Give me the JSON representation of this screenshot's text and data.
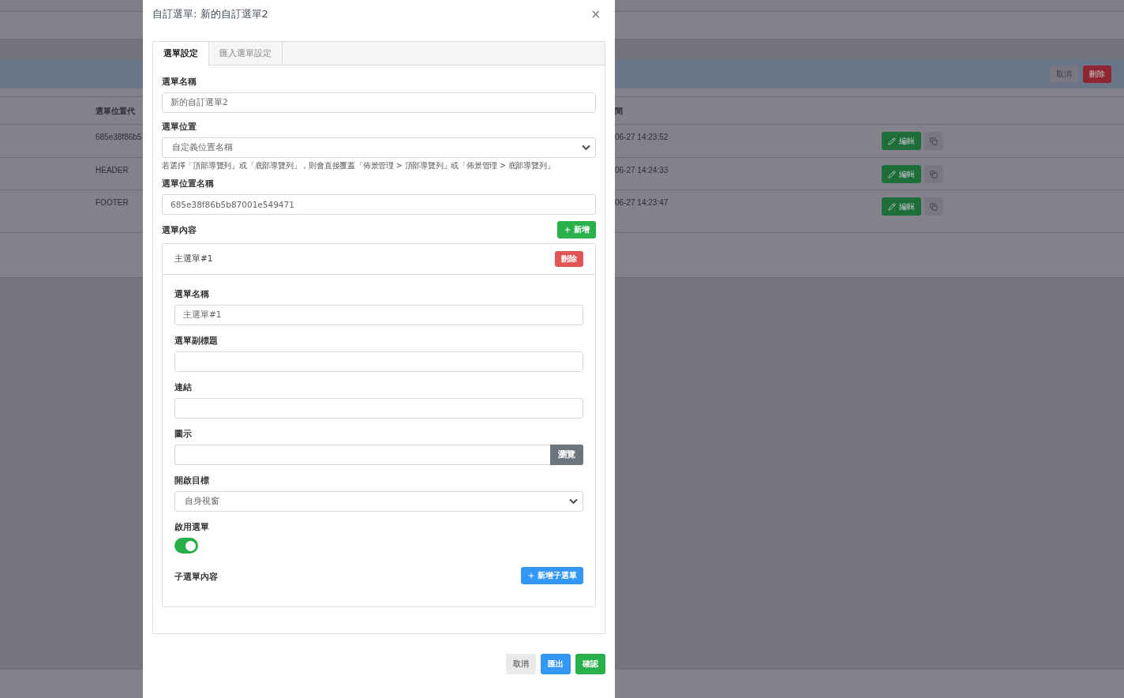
{
  "background": {
    "header_actions": [
      {
        "label": "取消",
        "kind": "secondary"
      },
      {
        "label": "刪除",
        "kind": "danger"
      }
    ],
    "table": {
      "column_1": "選單位置代",
      "column_2": "間",
      "rows": [
        {
          "column_1": "685e38f86b5",
          "column_2": "06-27 14:23:52",
          "action": "編輯"
        },
        {
          "column_1": "HEADER",
          "column_2": "06-27 14:24:33",
          "action": "編輯"
        },
        {
          "column_1": "FOOTER",
          "column_2": "06-27 14:23:47",
          "action": "編輯"
        }
      ]
    }
  },
  "modal": {
    "title": "自訂選單: 新的自訂選單2",
    "close": "×",
    "tabs": [
      {
        "label": "選單設定",
        "selected": true
      },
      {
        "label": "匯入選單設定",
        "selected": false
      }
    ],
    "menu_name": {
      "label": "選單名稱",
      "value": "新的自訂選單2"
    },
    "menu_position": {
      "label": "選單位置",
      "value": "自定義位置名稱",
      "help": "若選擇「頂部導覽列」或「底部導覽列」，則會直接覆蓋「佈景管理 > 頂部導覽列」或「佈景管理 > 底部導覽列」"
    },
    "position_name": {
      "label": "選單位置名稱",
      "value": "685e38f86b5b87001e549471"
    },
    "content": {
      "label": "選單內容",
      "add_button": "新增",
      "items": [
        {
          "title": "主選單#1",
          "delete_button": "刪除",
          "fields": [
            {
              "kind": "text",
              "label": "選單名稱",
              "value": "主選單#1"
            },
            {
              "kind": "text",
              "label": "選單副標題"
            },
            {
              "kind": "text",
              "label": "連結"
            },
            {
              "kind": "file",
              "label": "圖示",
              "button": "瀏覽"
            },
            {
              "kind": "select",
              "label": "開啟目標",
              "value": "自身視窗"
            },
            {
              "kind": "toggle",
              "label": "啟用選單",
              "on": true
            }
          ],
          "submenu": {
            "label": "子選單內容",
            "add_button": "新增子選單"
          }
        }
      ]
    },
    "footer_buttons": [
      {
        "label": "取消",
        "kind": "secondary"
      },
      {
        "label": "匯出",
        "kind": "primary"
      },
      {
        "label": "確認",
        "kind": "success"
      }
    ]
  }
}
